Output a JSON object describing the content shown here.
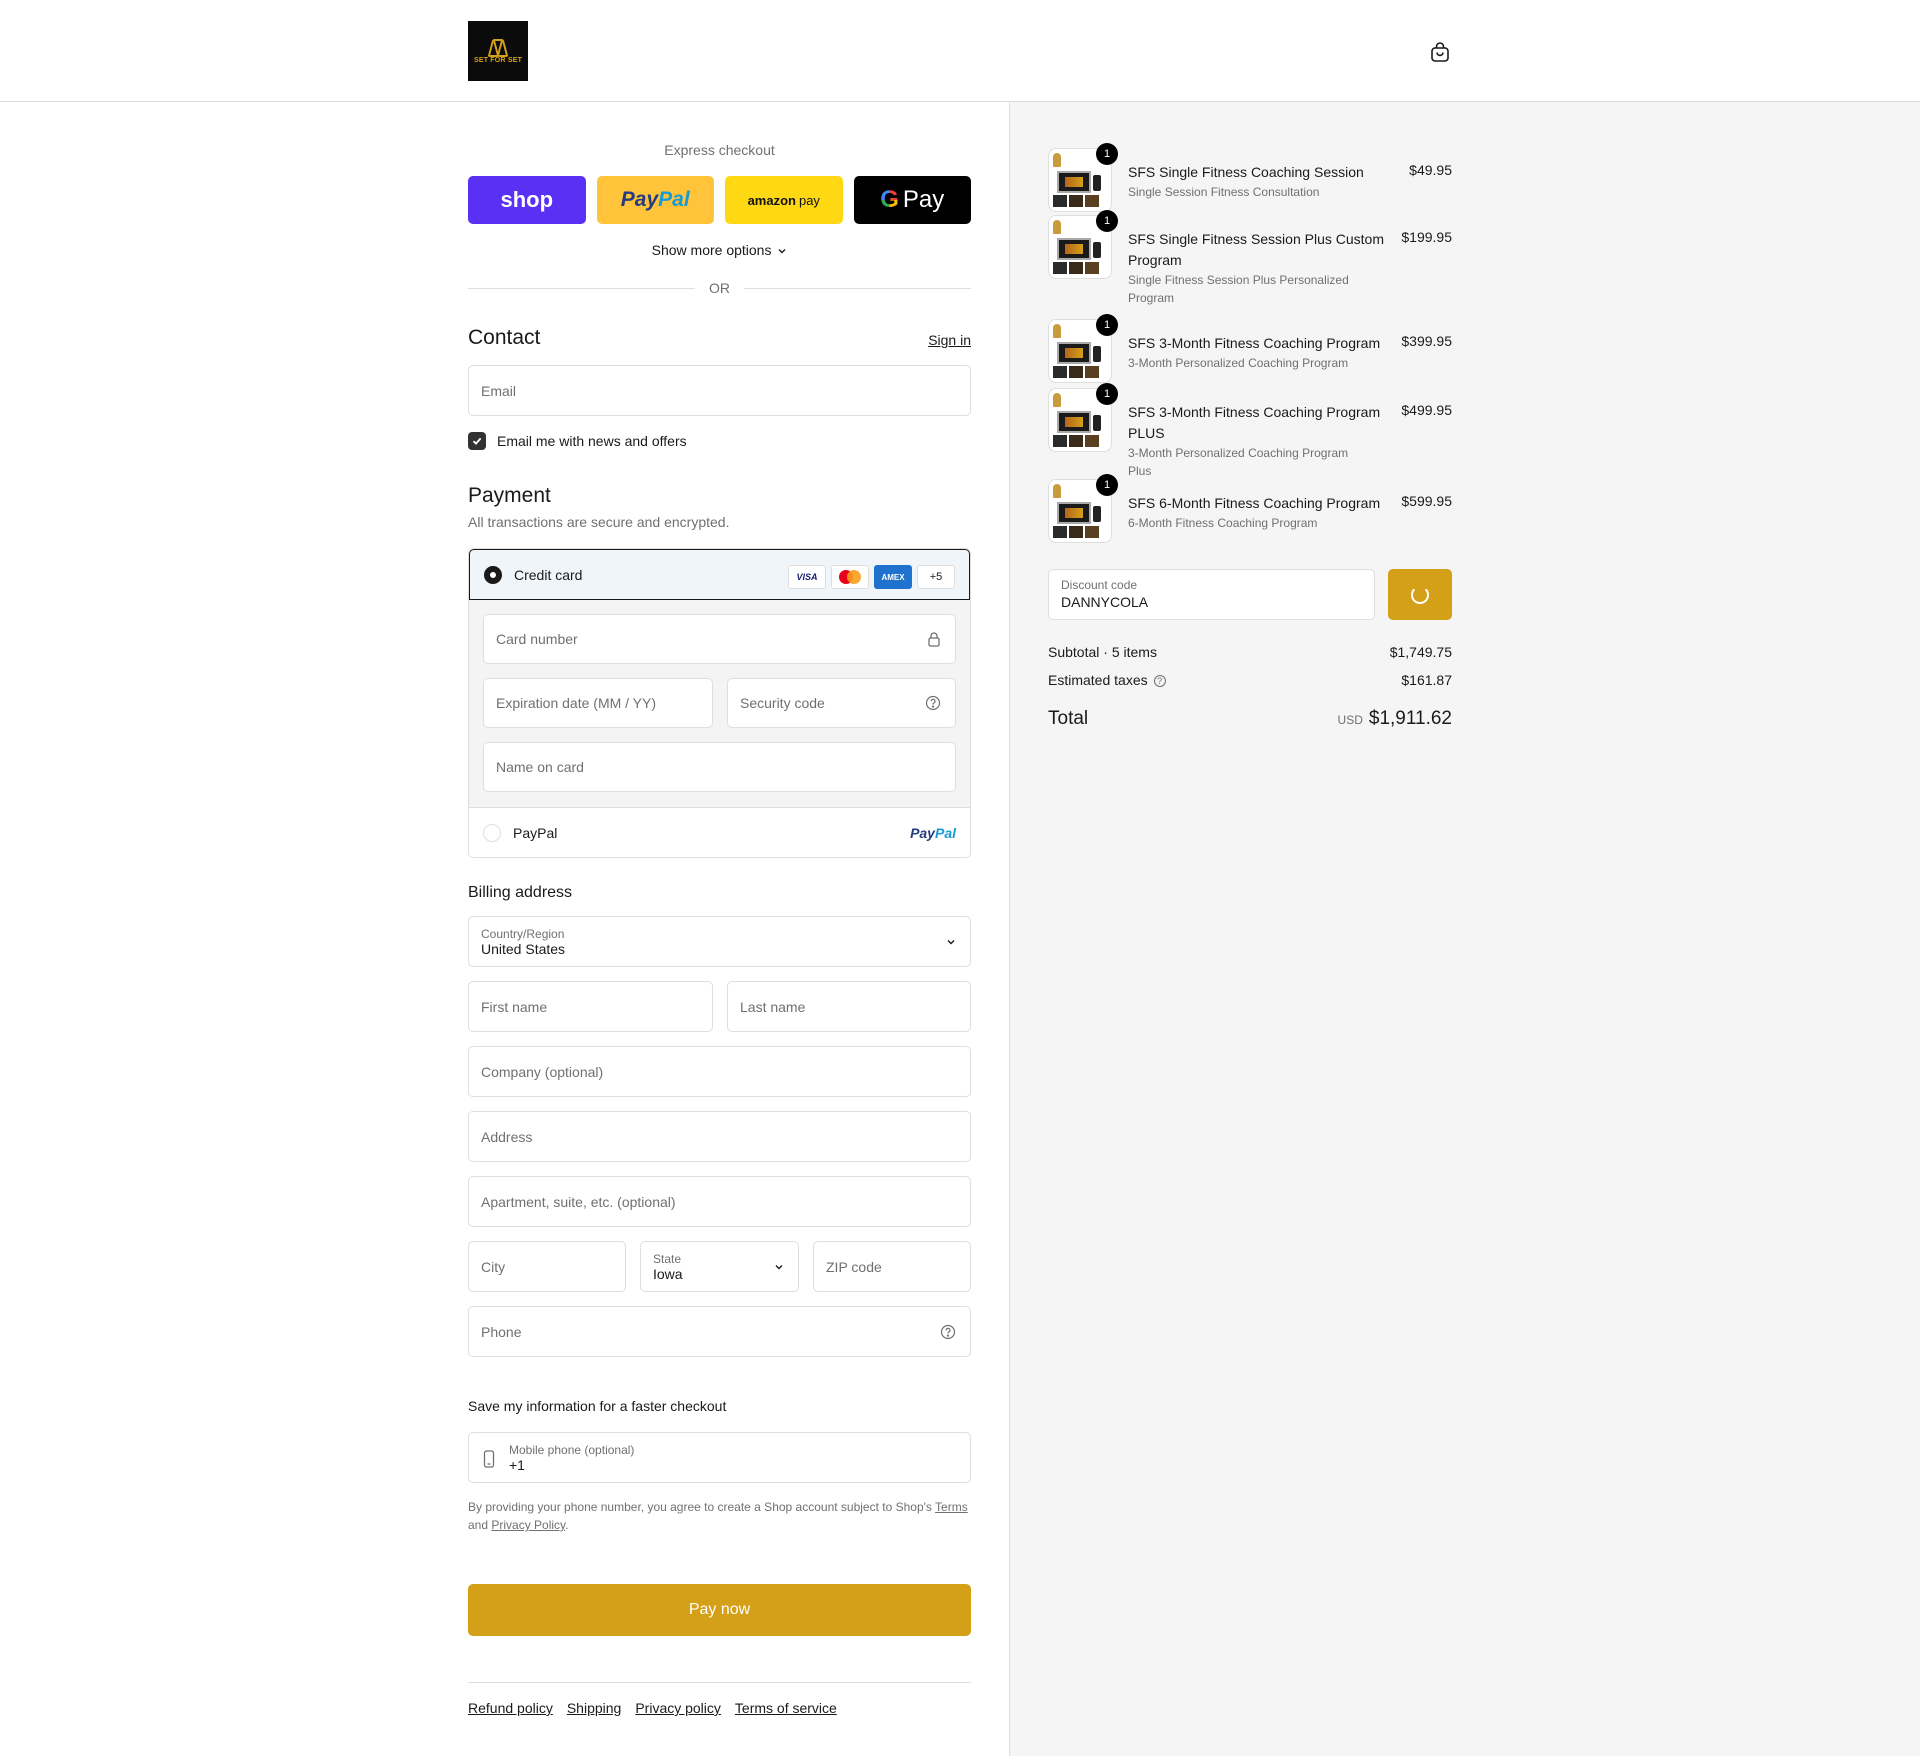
{
  "header": {
    "logo_text": "SET FOR SET",
    "cart_icon": "shopping-bag-icon"
  },
  "express": {
    "title": "Express checkout",
    "shop_label": "shop",
    "paypal_label_a": "Pay",
    "paypal_label_b": "Pal",
    "amazon_label_a": "amazon",
    "amazon_label_b": "pay",
    "gpay_g": "G",
    "gpay_label": "Pay",
    "show_more": "Show more options",
    "or": "OR"
  },
  "contact": {
    "title": "Contact",
    "sign_in": "Sign in",
    "email_placeholder": "Email",
    "news_label": "Email me with news and offers",
    "news_checked": true
  },
  "payment": {
    "title": "Payment",
    "subtitle": "All transactions are secure and encrypted.",
    "credit_card_label": "Credit card",
    "cards": [
      "VISA",
      "MASTERCARD",
      "AMEX",
      "+5"
    ],
    "card_number": "Card number",
    "expiration": "Expiration date (MM / YY)",
    "security_code": "Security code",
    "name_on_card": "Name on card",
    "paypal_label": "PayPal",
    "paypal_logo_a": "Pay",
    "paypal_logo_b": "Pal"
  },
  "billing": {
    "title": "Billing address",
    "country_label": "Country/Region",
    "country_value": "United States",
    "first_name": "First name",
    "last_name": "Last name",
    "company": "Company (optional)",
    "address": "Address",
    "apartment": "Apartment, suite, etc. (optional)",
    "city": "City",
    "state_label": "State",
    "state_value": "Iowa",
    "zip": "ZIP code",
    "phone": "Phone"
  },
  "save": {
    "title": "Save my information for a faster checkout",
    "mobile_label": "Mobile phone (optional)",
    "mobile_value": "+1",
    "fine_a": "By providing your phone number, you agree to create a Shop account subject to Shop's",
    "terms": "Terms",
    "fine_and": "and",
    "privacy": "Privacy Policy",
    "fine_end": "."
  },
  "pay_now": "Pay now",
  "footer": [
    "Refund policy",
    "Shipping",
    "Privacy policy",
    "Terms of service"
  ],
  "summary": {
    "items": [
      {
        "qty": "1",
        "title": "SFS Single Fitness Coaching Session",
        "sub": "Single Session Fitness Consultation",
        "price": "$49.95"
      },
      {
        "qty": "1",
        "title": "SFS Single Fitness Session Plus Custom Program",
        "sub": "Single Fitness Session Plus Personalized Program",
        "price": "$199.95"
      },
      {
        "qty": "1",
        "title": "SFS 3-Month Fitness Coaching Program",
        "sub": "3-Month Personalized Coaching Program",
        "price": "$399.95"
      },
      {
        "qty": "1",
        "title": "SFS 3-Month Fitness Coaching Program PLUS",
        "sub": "3-Month Personalized Coaching Program Plus",
        "price": "$499.95"
      },
      {
        "qty": "1",
        "title": "SFS 6-Month Fitness Coaching Program",
        "sub": "6-Month Fitness Coaching Program",
        "price": "$599.95"
      }
    ],
    "discount_label": "Discount code",
    "discount_value": "DANNYCOLA",
    "subtotal_label": "Subtotal · 5 items",
    "subtotal_value": "$1,749.75",
    "taxes_label": "Estimated taxes",
    "taxes_value": "$161.87",
    "total_label": "Total",
    "currency": "USD",
    "total_value": "$1,911.62"
  },
  "colors": {
    "accent": "#d4a017",
    "shop": "#5a31f4",
    "paypal": "#ffc439",
    "amazon": "#ffd814"
  }
}
